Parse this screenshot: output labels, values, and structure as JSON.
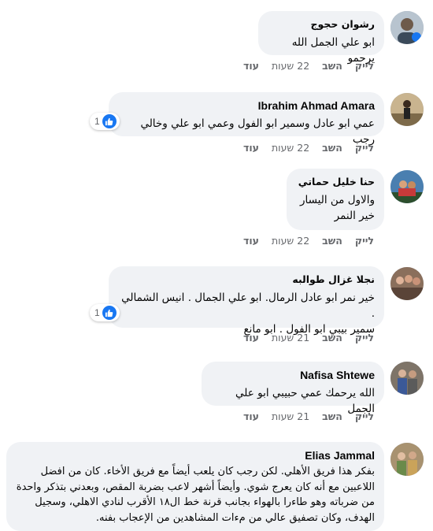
{
  "actions": {
    "more": "עוד",
    "reply": "השב",
    "like": "לייק"
  },
  "comments": [
    {
      "author": "رشوان حجوج",
      "text": "ابو علي الجمل الله يرحمو",
      "time": "22 שעות",
      "reactions": ""
    },
    {
      "author": "Ibrahim Ahmad Amara",
      "text": "عمي ابو عادل وسمير ابو الفول وعمي ابو علي وخالي رجب",
      "time": "22 שעות",
      "reactions": "1"
    },
    {
      "author": "حنا خليل حماتي",
      "text": "والاول من اليسار\nخير النمر",
      "time": "22 שעות",
      "reactions": ""
    },
    {
      "author": "نجلا غزال طوالبه",
      "text": "خير نمر ابو عادل الرمال. ابو علي الجمال . انيس الشمالي .\nسمير بيبي ابو الفول . ابو مانع",
      "time": "21 שעות",
      "reactions": "1"
    },
    {
      "author": "Nafisa Shtewe",
      "text": "الله يرحمك عمي حبيبي ابو علي الجمل",
      "time": "21 שעות",
      "reactions": ""
    },
    {
      "author": "Elias Jammal",
      "text": "بفكر هذا فريق الأهلي. لكن رجب كان يلعب أيضاً مع فريق الأخاء. كان من افضل اللاعبين مع أنه كان يعرج شوي. وأيضاً أشهر لاعب بضربة المقص، وبعدني بتذكر واحدة من ضرباته وهو طاءرا بالهواء بجانب قرنة خط ال١٨ الأقرب لنادي الاهلي، وسجيل الهدف، وكان تصفيق عالي من مءات المشاهدين من الإعجاب بفنه.",
      "time": "",
      "reactions": ""
    }
  ],
  "colors": {
    "bubble": "#f0f2f5",
    "like_blue": "#1877f2",
    "meta": "#65676b"
  }
}
